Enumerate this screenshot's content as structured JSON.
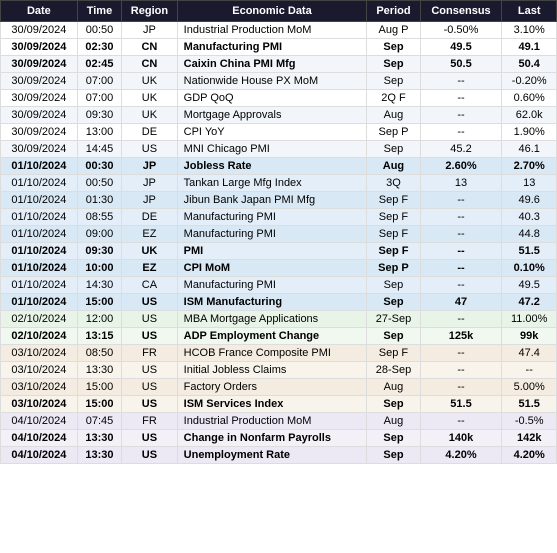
{
  "table": {
    "headers": [
      "Date",
      "Time",
      "Region",
      "Economic Data",
      "Period",
      "Consensus",
      "Last"
    ],
    "rows": [
      {
        "date": "30/09/2024",
        "time": "00:50",
        "region": "JP",
        "economic_data": "Industrial Production MoM",
        "period": "Aug P",
        "consensus": "-0.50%",
        "last": "3.10%",
        "type": "normal"
      },
      {
        "date": "30/09/2024",
        "time": "02:30",
        "region": "CN",
        "economic_data": "Manufacturing PMI",
        "period": "Sep",
        "consensus": "49.5",
        "last": "49.1",
        "type": "bold"
      },
      {
        "date": "30/09/2024",
        "time": "02:45",
        "region": "CN",
        "economic_data": "Caixin China PMI Mfg",
        "period": "Sep",
        "consensus": "50.5",
        "last": "50.4",
        "type": "bold"
      },
      {
        "date": "30/09/2024",
        "time": "07:00",
        "region": "UK",
        "economic_data": "Nationwide House PX MoM",
        "period": "Sep",
        "consensus": "--",
        "last": "-0.20%",
        "type": "normal"
      },
      {
        "date": "30/09/2024",
        "time": "07:00",
        "region": "UK",
        "economic_data": "GDP QoQ",
        "period": "2Q F",
        "consensus": "--",
        "last": "0.60%",
        "type": "normal"
      },
      {
        "date": "30/09/2024",
        "time": "09:30",
        "region": "UK",
        "economic_data": "Mortgage Approvals",
        "period": "Aug",
        "consensus": "--",
        "last": "62.0k",
        "type": "normal"
      },
      {
        "date": "30/09/2024",
        "time": "13:00",
        "region": "DE",
        "economic_data": "CPI YoY",
        "period": "Sep P",
        "consensus": "--",
        "last": "1.90%",
        "type": "normal"
      },
      {
        "date": "30/09/2024",
        "time": "14:45",
        "region": "US",
        "economic_data": "MNI Chicago PMI",
        "period": "Sep",
        "consensus": "45.2",
        "last": "46.1",
        "type": "normal"
      },
      {
        "date": "01/10/2024",
        "time": "00:30",
        "region": "JP",
        "economic_data": "Jobless Rate",
        "period": "Aug",
        "consensus": "2.60%",
        "last": "2.70%",
        "type": "section_bold"
      },
      {
        "date": "01/10/2024",
        "time": "00:50",
        "region": "JP",
        "economic_data": "Tankan Large Mfg Index",
        "period": "3Q",
        "consensus": "13",
        "last": "13",
        "type": "section_normal"
      },
      {
        "date": "01/10/2024",
        "time": "01:30",
        "region": "JP",
        "economic_data": "Jibun Bank Japan PMI Mfg",
        "period": "Sep F",
        "consensus": "--",
        "last": "49.6",
        "type": "section_normal"
      },
      {
        "date": "01/10/2024",
        "time": "08:55",
        "region": "DE",
        "economic_data": "Manufacturing PMI",
        "period": "Sep F",
        "consensus": "--",
        "last": "40.3",
        "type": "section_normal"
      },
      {
        "date": "01/10/2024",
        "time": "09:00",
        "region": "EZ",
        "economic_data": "Manufacturing PMI",
        "period": "Sep F",
        "consensus": "--",
        "last": "44.8",
        "type": "section_normal"
      },
      {
        "date": "01/10/2024",
        "time": "09:30",
        "region": "UK",
        "economic_data": "PMI",
        "period": "Sep F",
        "consensus": "--",
        "last": "51.5",
        "type": "section_bold"
      },
      {
        "date": "01/10/2024",
        "time": "10:00",
        "region": "EZ",
        "economic_data": "CPI MoM",
        "period": "Sep P",
        "consensus": "--",
        "last": "0.10%",
        "type": "section_bold"
      },
      {
        "date": "01/10/2024",
        "time": "14:30",
        "region": "CA",
        "economic_data": "Manufacturing PMI",
        "period": "Sep",
        "consensus": "--",
        "last": "49.5",
        "type": "section_normal"
      },
      {
        "date": "01/10/2024",
        "time": "15:00",
        "region": "US",
        "economic_data": "ISM Manufacturing",
        "period": "Sep",
        "consensus": "47",
        "last": "47.2",
        "type": "section_bold"
      },
      {
        "date": "02/10/2024",
        "time": "12:00",
        "region": "US",
        "economic_data": "MBA Mortgage Applications",
        "period": "27-Sep",
        "consensus": "--",
        "last": "11.00%",
        "type": "section2_normal"
      },
      {
        "date": "02/10/2024",
        "time": "13:15",
        "region": "US",
        "economic_data": "ADP Employment Change",
        "period": "Sep",
        "consensus": "125k",
        "last": "99k",
        "type": "section2_bold"
      },
      {
        "date": "03/10/2024",
        "time": "08:50",
        "region": "FR",
        "economic_data": "HCOB France Composite PMI",
        "period": "Sep F",
        "consensus": "--",
        "last": "47.4",
        "type": "section3_normal"
      },
      {
        "date": "03/10/2024",
        "time": "13:30",
        "region": "US",
        "economic_data": "Initial Jobless Claims",
        "period": "28-Sep",
        "consensus": "--",
        "last": "--",
        "type": "section3_normal"
      },
      {
        "date": "03/10/2024",
        "time": "15:00",
        "region": "US",
        "economic_data": "Factory Orders",
        "period": "Aug",
        "consensus": "--",
        "last": "5.00%",
        "type": "section3_normal"
      },
      {
        "date": "03/10/2024",
        "time": "15:00",
        "region": "US",
        "economic_data": "ISM Services Index",
        "period": "Sep",
        "consensus": "51.5",
        "last": "51.5",
        "type": "section3_bold"
      },
      {
        "date": "04/10/2024",
        "time": "07:45",
        "region": "FR",
        "economic_data": "Industrial Production MoM",
        "period": "Aug",
        "consensus": "--",
        "last": "-0.5%",
        "type": "section4_normal"
      },
      {
        "date": "04/10/2024",
        "time": "13:30",
        "region": "US",
        "economic_data": "Change in Nonfarm Payrolls",
        "period": "Sep",
        "consensus": "140k",
        "last": "142k",
        "type": "section4_bold"
      },
      {
        "date": "04/10/2024",
        "time": "13:30",
        "region": "US",
        "economic_data": "Unemployment Rate",
        "period": "Sep",
        "consensus": "4.20%",
        "last": "4.20%",
        "type": "section4_bold"
      }
    ]
  }
}
